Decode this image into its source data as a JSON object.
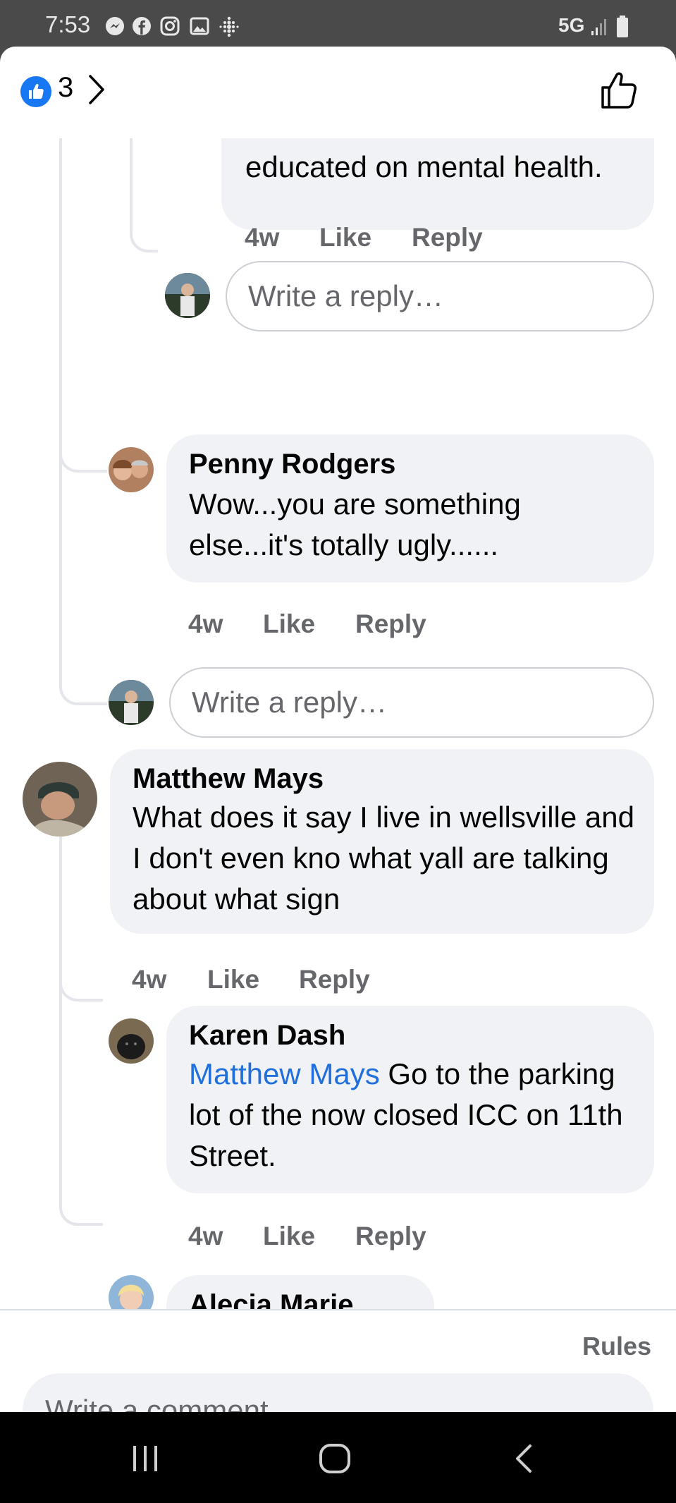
{
  "status_bar": {
    "time": "7:53",
    "network": "5G"
  },
  "header": {
    "like_count": "3"
  },
  "comments": {
    "top_fragment": {
      "text": "educated on mental health.",
      "time": "4w",
      "like": "Like",
      "reply": "Reply"
    },
    "reply_box_1": {
      "placeholder": "Write a reply…"
    },
    "penny": {
      "author": "Penny Rodgers",
      "text": "Wow...you are something else...it's totally ugly......",
      "time": "4w",
      "like": "Like",
      "reply": "Reply"
    },
    "reply_box_2": {
      "placeholder": "Write a reply…"
    },
    "matthew": {
      "author": "Matthew Mays",
      "text": "What does it say I live in wellsville and I don't even kno what yall are talking about what sign",
      "time": "4w",
      "like": "Like",
      "reply": "Reply"
    },
    "karen": {
      "author": "Karen Dash",
      "mention": "Matthew Mays",
      "text": " Go to the parking lot of the now closed ICC on 11th Street.",
      "time": "4w",
      "like": "Like",
      "reply": "Reply"
    },
    "alecia": {
      "author": "Alecia Marie"
    }
  },
  "composer": {
    "rules": "Rules",
    "placeholder": "Write a comment…"
  },
  "colors": {
    "accent": "#1877f2",
    "mention": "#216fdb",
    "bubble": "#f0f2f5",
    "meta": "#65676b"
  }
}
